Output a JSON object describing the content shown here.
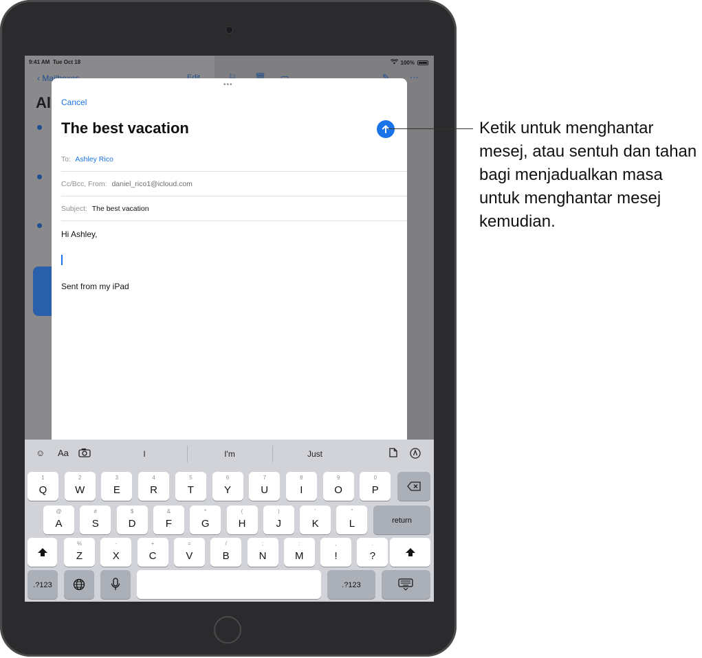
{
  "status_bar": {
    "time": "9:41 AM",
    "date": "Tue Oct 18",
    "battery": "100%"
  },
  "mail_list": {
    "back_label": "Mailboxes",
    "edit_label": "Edit",
    "title": "All"
  },
  "compose": {
    "cancel_label": "Cancel",
    "title": "The best vacation",
    "to_label": "To:",
    "to_value": "Ashley Rico",
    "cc_label": "Cc/Bcc, From:",
    "cc_value": "daniel_rico1@icloud.com",
    "subject_label": "Subject:",
    "subject_value": "The best vacation",
    "greeting": "Hi Ashley,",
    "signature": "Sent from my iPad"
  },
  "keyboard": {
    "suggestions": [
      "I",
      "I'm",
      "Just"
    ],
    "row1": [
      {
        "k": "Q",
        "s": "1"
      },
      {
        "k": "W",
        "s": "2"
      },
      {
        "k": "E",
        "s": "3"
      },
      {
        "k": "R",
        "s": "4"
      },
      {
        "k": "T",
        "s": "5"
      },
      {
        "k": "Y",
        "s": "6"
      },
      {
        "k": "U",
        "s": "7"
      },
      {
        "k": "I",
        "s": "8"
      },
      {
        "k": "O",
        "s": "9"
      },
      {
        "k": "P",
        "s": "0"
      }
    ],
    "row2": [
      {
        "k": "A",
        "s": "@"
      },
      {
        "k": "S",
        "s": "#"
      },
      {
        "k": "D",
        "s": "$"
      },
      {
        "k": "F",
        "s": "&"
      },
      {
        "k": "G",
        "s": "*"
      },
      {
        "k": "H",
        "s": "("
      },
      {
        "k": "J",
        "s": ")"
      },
      {
        "k": "K",
        "s": "'"
      },
      {
        "k": "L",
        "s": "\""
      }
    ],
    "row3": [
      {
        "k": "Z",
        "s": "%"
      },
      {
        "k": "X",
        "s": "-"
      },
      {
        "k": "C",
        "s": "+"
      },
      {
        "k": "V",
        "s": "="
      },
      {
        "k": "B",
        "s": "/"
      },
      {
        "k": "N",
        "s": ";"
      },
      {
        "k": "M",
        "s": ":"
      },
      {
        "k": "!",
        "s": ","
      },
      {
        "k": "?",
        "s": "."
      }
    ],
    "return_label": "return",
    "numbers_label": ".?123"
  },
  "callout": {
    "text": "Ketik untuk menghantar mesej, atau sentuh dan tahan bagi menjadualkan masa untuk menghantar mesej kemudian."
  },
  "colors": {
    "accent": "#1a73e8",
    "keyboard_bg": "#d1d3d9",
    "device": "#2b2b2d"
  }
}
